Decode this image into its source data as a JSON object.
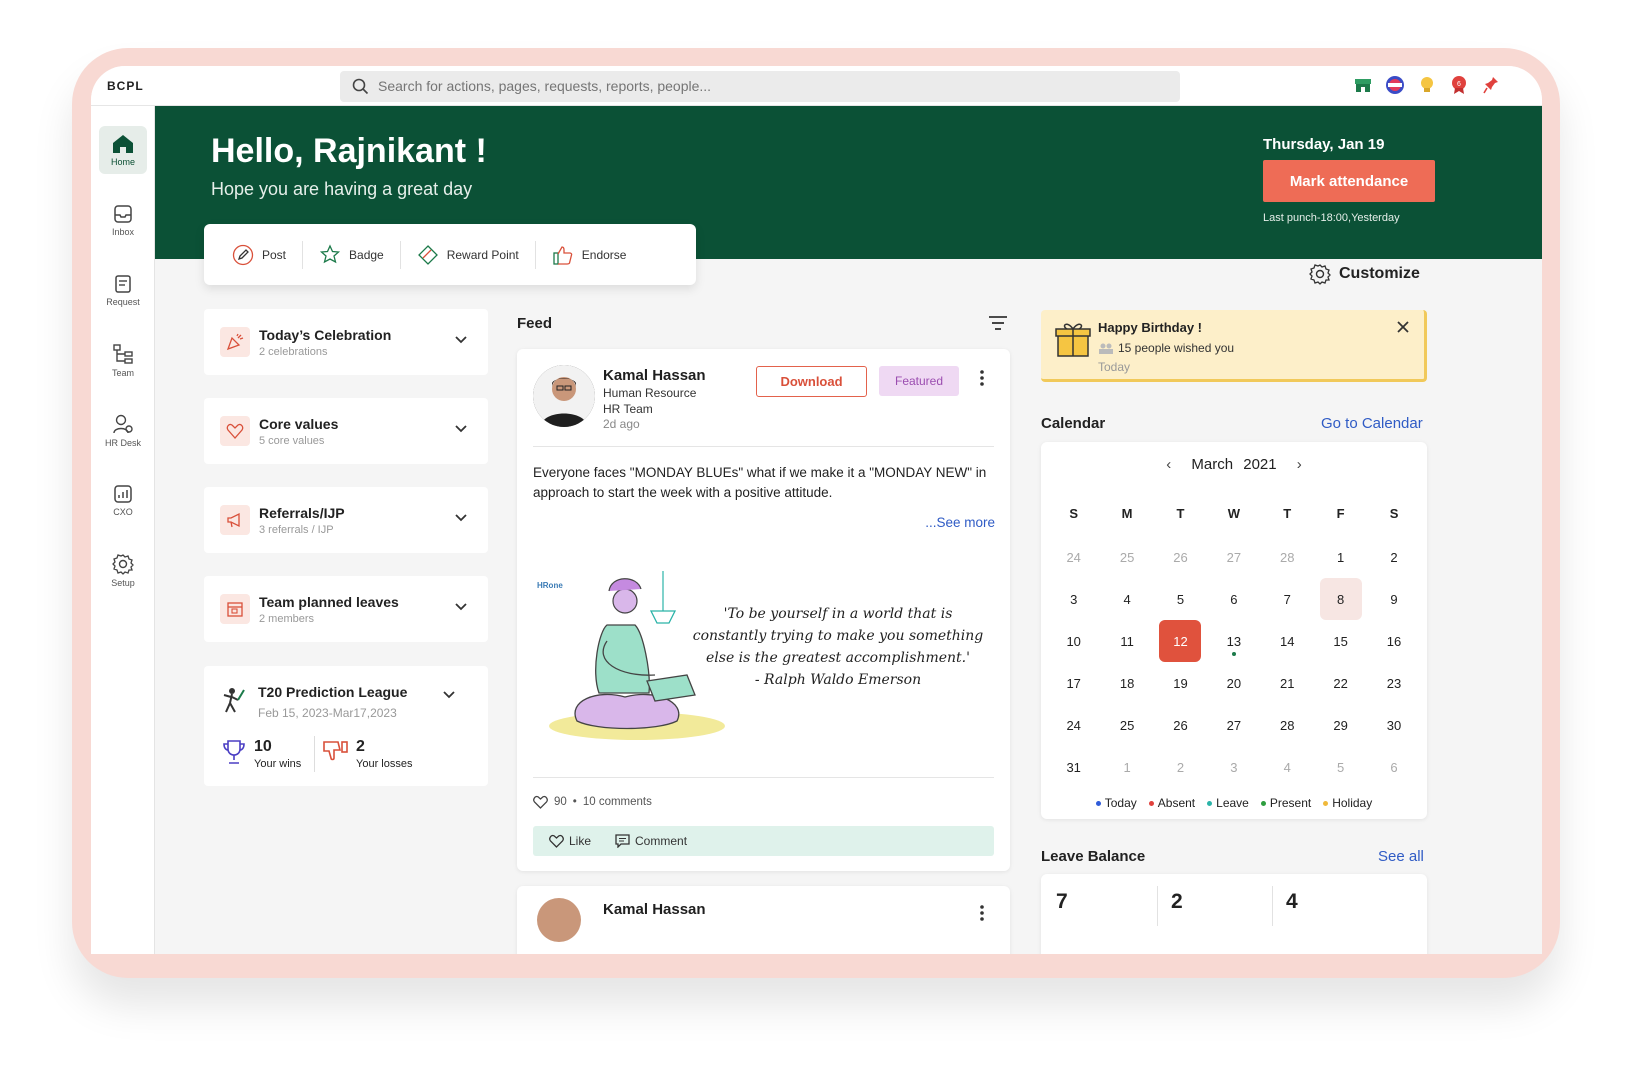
{
  "topbar": {
    "brand": "BCPL",
    "search_placeholder": "Search for actions, pages, requests, reports, people..."
  },
  "sidebar": {
    "items": [
      {
        "label": "Home",
        "icon": "home-icon"
      },
      {
        "label": "Inbox",
        "icon": "inbox-icon"
      },
      {
        "label": "Request",
        "icon": "request-icon"
      },
      {
        "label": "Team",
        "icon": "team-icon"
      },
      {
        "label": "HR Desk",
        "icon": "hr-desk-icon"
      },
      {
        "label": "CXO",
        "icon": "cxo-icon"
      },
      {
        "label": "Setup",
        "icon": "setup-icon"
      }
    ]
  },
  "banner": {
    "greeting": "Hello, Rajnikant !",
    "subtitle": "Hope you are having a great day",
    "date": "Thursday, Jan 19",
    "mark_attendance": "Mark attendance",
    "last_punch": "Last punch-18:00,Yesterday",
    "color": "#0b5136"
  },
  "actions": [
    {
      "label": "Post",
      "icon": "pencil-icon"
    },
    {
      "label": "Badge",
      "icon": "badge-icon"
    },
    {
      "label": "Reward Point",
      "icon": "reward-icon"
    },
    {
      "label": "Endorse",
      "icon": "thumbs-up-icon"
    }
  ],
  "customize_label": "Customize",
  "left_cards": [
    {
      "title": "Today’s Celebration",
      "subtitle": "2 celebrations"
    },
    {
      "title": "Core values",
      "subtitle": "5 core values"
    },
    {
      "title": "Referrals/IJP",
      "subtitle": "3 referrals / IJP"
    },
    {
      "title": "Team planned leaves",
      "subtitle": "2 members"
    }
  ],
  "t20": {
    "title": "T20 Prediction League",
    "dates": "Feb 15, 2023-Mar17,2023",
    "wins": "10",
    "wins_label": "Your wins",
    "losses": "2",
    "losses_label": "Your losses"
  },
  "feed": {
    "title": "Feed",
    "post": {
      "author": "Kamal Hassan",
      "department": "Human Resource",
      "team": "HR Team",
      "time": "2d ago",
      "download": "Download",
      "featured": "Featured",
      "text": "Everyone faces \"MONDAY BLUEs\" what if we make it a \"MONDAY NEW\" in approach to start the week with a positive attitude.",
      "see_more": "...See more",
      "image_brand": "HRone",
      "quote": "'To be yourself in a world that is constantly trying to make you something else is the greatest accomplishment.'",
      "quote_author": "- Ralph Waldo Emerson",
      "likes": "90",
      "comments": "10 comments",
      "like_label": "Like",
      "comment_label": "Comment"
    },
    "post2": {
      "author": "Kamal Hassan"
    }
  },
  "birthday": {
    "title": "Happy Birthday !",
    "wished": "15 people wished you",
    "when": "Today"
  },
  "calendar": {
    "title": "Calendar",
    "go_to": "Go to Calendar",
    "month": "March",
    "year": "2021",
    "weekdays": [
      "S",
      "M",
      "T",
      "W",
      "T",
      "F",
      "S"
    ],
    "days": [
      [
        "24",
        "25",
        "26",
        "27",
        "28",
        "1",
        "2"
      ],
      [
        "3",
        "4",
        "5",
        "6",
        "7",
        "8",
        "9"
      ],
      [
        "10",
        "11",
        "12",
        "13",
        "14",
        "15",
        "16"
      ],
      [
        "17",
        "18",
        "19",
        "20",
        "21",
        "22",
        "23"
      ],
      [
        "24",
        "25",
        "26",
        "27",
        "28",
        "29",
        "30"
      ],
      [
        "31",
        "1",
        "2",
        "3",
        "4",
        "5",
        "6"
      ]
    ],
    "today": "12",
    "selected": "8",
    "marked": "13",
    "legend": [
      {
        "label": "Today",
        "color": "#2f5bd9"
      },
      {
        "label": "Absent",
        "color": "#e0413d"
      },
      {
        "label": "Leave",
        "color": "#2bb3a8"
      },
      {
        "label": "Present",
        "color": "#2e9e3f"
      },
      {
        "label": "Holiday",
        "color": "#f0b93a"
      }
    ]
  },
  "leave_balance": {
    "title": "Leave Balance",
    "see_all": "See all",
    "values": [
      "7",
      "2",
      "4"
    ]
  }
}
